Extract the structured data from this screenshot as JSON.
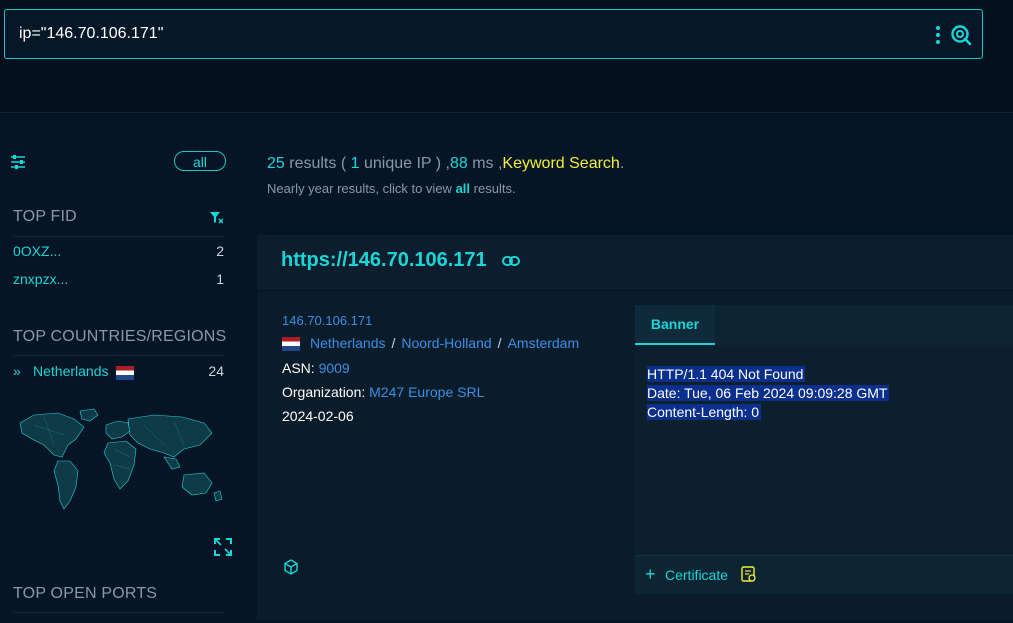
{
  "search": {
    "query": "ip=\"146.70.106.171\""
  },
  "sidebar": {
    "all_label": "all",
    "top_fid_title": "TOP FID",
    "fids": [
      {
        "name": "0OXZ...",
        "count": "2"
      },
      {
        "name": "znxpzx...",
        "count": "1"
      }
    ],
    "top_countries_title": "TOP COUNTRIES/REGIONS",
    "countries": [
      {
        "name": "Netherlands",
        "count": "24"
      }
    ],
    "top_ports_title": "TOP OPEN PORTS"
  },
  "summary": {
    "count": "25",
    "results_word": "results (",
    "unique": "1",
    "unique_word": "unique IP ) ,",
    "ms": "88",
    "ms_word": "ms ,",
    "keyword": "Keyword Search",
    "period": ".",
    "sub_pre": "Nearly year results, click to view",
    "sub_link": "all",
    "sub_post": "results."
  },
  "card": {
    "url": "https://146.70.106.171",
    "ip": "146.70.106.171",
    "country": "Netherlands",
    "region": "Noord-Holland",
    "city": "Amsterdam",
    "asn_label": "ASN:",
    "asn": "9009",
    "org_label": "Organization:",
    "org": "M247 Europe SRL",
    "date": "2024-02-06",
    "banner_tab": "Banner",
    "banner_lines": [
      "HTTP/1.1 404 Not Found",
      "Date: Tue, 06 Feb 2024 09:09:28 GMT",
      "Content-Length: 0"
    ],
    "certificate_label": "Certificate"
  },
  "colors": {
    "accent": "#19d6d6",
    "link": "#3b8fe6",
    "keyword": "#f4ef3a"
  }
}
